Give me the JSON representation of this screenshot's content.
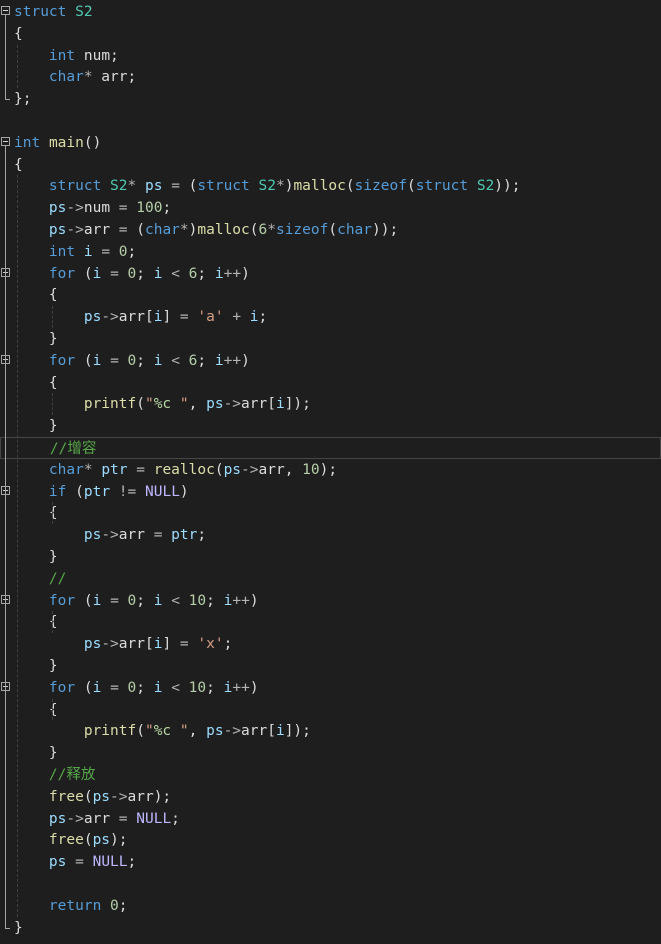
{
  "editor": {
    "language": "C",
    "colors": {
      "background": "#1e1e1e",
      "keyword": "#569cd6",
      "type": "#4ec9b0",
      "number": "#b5cea8",
      "string": "#d69d85",
      "comment": "#57a64a",
      "function": "#dcdcaa",
      "macro": "#beb7ff",
      "local": "#9cdcfe",
      "operator": "#b4b4b4",
      "plain": "#dcdcdc"
    },
    "current_line": 20,
    "lines": [
      {
        "fold": true,
        "tokens": [
          [
            "kw",
            "struct"
          ],
          [
            "plain",
            " "
          ],
          [
            "type",
            "S2"
          ]
        ]
      },
      {
        "tokens": [
          [
            "plain",
            "{"
          ]
        ]
      },
      {
        "tokens": [
          [
            "plain",
            "    "
          ],
          [
            "kw",
            "int"
          ],
          [
            "plain",
            " num;"
          ]
        ]
      },
      {
        "tokens": [
          [
            "plain",
            "    "
          ],
          [
            "kw",
            "char"
          ],
          [
            "op",
            "*"
          ],
          [
            "plain",
            " arr;"
          ]
        ]
      },
      {
        "tokens": [
          [
            "plain",
            "};"
          ]
        ]
      },
      {
        "tokens": []
      },
      {
        "fold": true,
        "tokens": [
          [
            "kw",
            "int"
          ],
          [
            "plain",
            " "
          ],
          [
            "fn",
            "main"
          ],
          [
            "plain",
            "()"
          ]
        ]
      },
      {
        "tokens": [
          [
            "plain",
            "{"
          ]
        ]
      },
      {
        "tokens": [
          [
            "plain",
            "    "
          ],
          [
            "kw",
            "struct"
          ],
          [
            "plain",
            " "
          ],
          [
            "type",
            "S2"
          ],
          [
            "op",
            "*"
          ],
          [
            "plain",
            " "
          ],
          [
            "local",
            "ps"
          ],
          [
            "plain",
            " "
          ],
          [
            "op",
            "="
          ],
          [
            "plain",
            " ("
          ],
          [
            "kw",
            "struct"
          ],
          [
            "plain",
            " "
          ],
          [
            "type",
            "S2"
          ],
          [
            "op",
            "*"
          ],
          [
            "plain",
            ")"
          ],
          [
            "fn",
            "malloc"
          ],
          [
            "plain",
            "("
          ],
          [
            "kw",
            "sizeof"
          ],
          [
            "plain",
            "("
          ],
          [
            "kw",
            "struct"
          ],
          [
            "plain",
            " "
          ],
          [
            "type",
            "S2"
          ],
          [
            "plain",
            "));"
          ]
        ]
      },
      {
        "tokens": [
          [
            "plain",
            "    "
          ],
          [
            "local",
            "ps"
          ],
          [
            "op",
            "->"
          ],
          [
            "plain",
            "num "
          ],
          [
            "op",
            "="
          ],
          [
            "plain",
            " "
          ],
          [
            "num",
            "100"
          ],
          [
            "plain",
            ";"
          ]
        ]
      },
      {
        "tokens": [
          [
            "plain",
            "    "
          ],
          [
            "local",
            "ps"
          ],
          [
            "op",
            "->"
          ],
          [
            "plain",
            "arr "
          ],
          [
            "op",
            "="
          ],
          [
            "plain",
            " ("
          ],
          [
            "kw",
            "char"
          ],
          [
            "op",
            "*"
          ],
          [
            "plain",
            ")"
          ],
          [
            "fn",
            "malloc"
          ],
          [
            "plain",
            "("
          ],
          [
            "num",
            "6"
          ],
          [
            "op",
            "*"
          ],
          [
            "kw",
            "sizeof"
          ],
          [
            "plain",
            "("
          ],
          [
            "kw",
            "char"
          ],
          [
            "plain",
            "));"
          ]
        ]
      },
      {
        "tokens": [
          [
            "plain",
            "    "
          ],
          [
            "kw",
            "int"
          ],
          [
            "plain",
            " "
          ],
          [
            "local",
            "i"
          ],
          [
            "plain",
            " "
          ],
          [
            "op",
            "="
          ],
          [
            "plain",
            " "
          ],
          [
            "num",
            "0"
          ],
          [
            "plain",
            ";"
          ]
        ]
      },
      {
        "fold": true,
        "tokens": [
          [
            "plain",
            "    "
          ],
          [
            "kw",
            "for"
          ],
          [
            "plain",
            " ("
          ],
          [
            "local",
            "i"
          ],
          [
            "plain",
            " "
          ],
          [
            "op",
            "="
          ],
          [
            "plain",
            " "
          ],
          [
            "num",
            "0"
          ],
          [
            "plain",
            "; "
          ],
          [
            "local",
            "i"
          ],
          [
            "plain",
            " "
          ],
          [
            "op",
            "<"
          ],
          [
            "plain",
            " "
          ],
          [
            "num",
            "6"
          ],
          [
            "plain",
            "; "
          ],
          [
            "local",
            "i"
          ],
          [
            "op",
            "++"
          ],
          [
            "plain",
            ")"
          ]
        ]
      },
      {
        "tokens": [
          [
            "plain",
            "    {"
          ]
        ]
      },
      {
        "tokens": [
          [
            "plain",
            "        "
          ],
          [
            "local",
            "ps"
          ],
          [
            "op",
            "->"
          ],
          [
            "plain",
            "arr["
          ],
          [
            "local",
            "i"
          ],
          [
            "plain",
            "] "
          ],
          [
            "op",
            "="
          ],
          [
            "plain",
            " "
          ],
          [
            "str",
            "'a'"
          ],
          [
            "plain",
            " "
          ],
          [
            "op",
            "+"
          ],
          [
            "plain",
            " "
          ],
          [
            "local",
            "i"
          ],
          [
            "plain",
            ";"
          ]
        ]
      },
      {
        "tokens": [
          [
            "plain",
            "    }"
          ]
        ]
      },
      {
        "fold": true,
        "tokens": [
          [
            "plain",
            "    "
          ],
          [
            "kw",
            "for"
          ],
          [
            "plain",
            " ("
          ],
          [
            "local",
            "i"
          ],
          [
            "plain",
            " "
          ],
          [
            "op",
            "="
          ],
          [
            "plain",
            " "
          ],
          [
            "num",
            "0"
          ],
          [
            "plain",
            "; "
          ],
          [
            "local",
            "i"
          ],
          [
            "plain",
            " "
          ],
          [
            "op",
            "<"
          ],
          [
            "plain",
            " "
          ],
          [
            "num",
            "6"
          ],
          [
            "plain",
            "; "
          ],
          [
            "local",
            "i"
          ],
          [
            "op",
            "++"
          ],
          [
            "plain",
            ")"
          ]
        ]
      },
      {
        "tokens": [
          [
            "plain",
            "    {"
          ]
        ]
      },
      {
        "tokens": [
          [
            "plain",
            "        "
          ],
          [
            "fn",
            "printf"
          ],
          [
            "plain",
            "("
          ],
          [
            "str",
            "\""
          ],
          [
            "fmt",
            "%c"
          ],
          [
            "str",
            " \""
          ],
          [
            "plain",
            ", "
          ],
          [
            "local",
            "ps"
          ],
          [
            "op",
            "->"
          ],
          [
            "plain",
            "arr["
          ],
          [
            "local",
            "i"
          ],
          [
            "plain",
            "]);"
          ]
        ]
      },
      {
        "tokens": [
          [
            "plain",
            "    }"
          ]
        ]
      },
      {
        "tokens": [
          [
            "plain",
            "    "
          ],
          [
            "cmt",
            "//增容"
          ]
        ]
      },
      {
        "tokens": [
          [
            "plain",
            "    "
          ],
          [
            "kw",
            "char"
          ],
          [
            "op",
            "*"
          ],
          [
            "plain",
            " "
          ],
          [
            "local",
            "ptr"
          ],
          [
            "plain",
            " "
          ],
          [
            "op",
            "="
          ],
          [
            "plain",
            " "
          ],
          [
            "fn",
            "realloc"
          ],
          [
            "plain",
            "("
          ],
          [
            "local",
            "ps"
          ],
          [
            "op",
            "->"
          ],
          [
            "plain",
            "arr, "
          ],
          [
            "num",
            "10"
          ],
          [
            "plain",
            ");"
          ]
        ]
      },
      {
        "fold": true,
        "tokens": [
          [
            "plain",
            "    "
          ],
          [
            "kw",
            "if"
          ],
          [
            "plain",
            " ("
          ],
          [
            "local",
            "ptr"
          ],
          [
            "plain",
            " "
          ],
          [
            "op",
            "!="
          ],
          [
            "plain",
            " "
          ],
          [
            "macro",
            "NULL"
          ],
          [
            "plain",
            ")"
          ]
        ]
      },
      {
        "tokens": [
          [
            "plain",
            "    {"
          ]
        ]
      },
      {
        "tokens": [
          [
            "plain",
            "        "
          ],
          [
            "local",
            "ps"
          ],
          [
            "op",
            "->"
          ],
          [
            "plain",
            "arr "
          ],
          [
            "op",
            "="
          ],
          [
            "plain",
            " "
          ],
          [
            "local",
            "ptr"
          ],
          [
            "plain",
            ";"
          ]
        ]
      },
      {
        "tokens": [
          [
            "plain",
            "    }"
          ]
        ]
      },
      {
        "tokens": [
          [
            "plain",
            "    "
          ],
          [
            "cmt",
            "//"
          ]
        ]
      },
      {
        "fold": true,
        "tokens": [
          [
            "plain",
            "    "
          ],
          [
            "kw",
            "for"
          ],
          [
            "plain",
            " ("
          ],
          [
            "local",
            "i"
          ],
          [
            "plain",
            " "
          ],
          [
            "op",
            "="
          ],
          [
            "plain",
            " "
          ],
          [
            "num",
            "0"
          ],
          [
            "plain",
            "; "
          ],
          [
            "local",
            "i"
          ],
          [
            "plain",
            " "
          ],
          [
            "op",
            "<"
          ],
          [
            "plain",
            " "
          ],
          [
            "num",
            "10"
          ],
          [
            "plain",
            "; "
          ],
          [
            "local",
            "i"
          ],
          [
            "op",
            "++"
          ],
          [
            "plain",
            ")"
          ]
        ]
      },
      {
        "tokens": [
          [
            "plain",
            "    {"
          ]
        ]
      },
      {
        "tokens": [
          [
            "plain",
            "        "
          ],
          [
            "local",
            "ps"
          ],
          [
            "op",
            "->"
          ],
          [
            "plain",
            "arr["
          ],
          [
            "local",
            "i"
          ],
          [
            "plain",
            "] "
          ],
          [
            "op",
            "="
          ],
          [
            "plain",
            " "
          ],
          [
            "str",
            "'x'"
          ],
          [
            "plain",
            ";"
          ]
        ]
      },
      {
        "tokens": [
          [
            "plain",
            "    }"
          ]
        ]
      },
      {
        "fold": true,
        "tokens": [
          [
            "plain",
            "    "
          ],
          [
            "kw",
            "for"
          ],
          [
            "plain",
            " ("
          ],
          [
            "local",
            "i"
          ],
          [
            "plain",
            " "
          ],
          [
            "op",
            "="
          ],
          [
            "plain",
            " "
          ],
          [
            "num",
            "0"
          ],
          [
            "plain",
            "; "
          ],
          [
            "local",
            "i"
          ],
          [
            "plain",
            " "
          ],
          [
            "op",
            "<"
          ],
          [
            "plain",
            " "
          ],
          [
            "num",
            "10"
          ],
          [
            "plain",
            "; "
          ],
          [
            "local",
            "i"
          ],
          [
            "op",
            "++"
          ],
          [
            "plain",
            ")"
          ]
        ]
      },
      {
        "tokens": [
          [
            "plain",
            "    {"
          ]
        ]
      },
      {
        "tokens": [
          [
            "plain",
            "        "
          ],
          [
            "fn",
            "printf"
          ],
          [
            "plain",
            "("
          ],
          [
            "str",
            "\""
          ],
          [
            "fmt",
            "%c"
          ],
          [
            "str",
            " \""
          ],
          [
            "plain",
            ", "
          ],
          [
            "local",
            "ps"
          ],
          [
            "op",
            "->"
          ],
          [
            "plain",
            "arr["
          ],
          [
            "local",
            "i"
          ],
          [
            "plain",
            "]);"
          ]
        ]
      },
      {
        "tokens": [
          [
            "plain",
            "    }"
          ]
        ]
      },
      {
        "tokens": [
          [
            "plain",
            "    "
          ],
          [
            "cmt",
            "//释放"
          ]
        ]
      },
      {
        "tokens": [
          [
            "plain",
            "    "
          ],
          [
            "fn",
            "free"
          ],
          [
            "plain",
            "("
          ],
          [
            "local",
            "ps"
          ],
          [
            "op",
            "->"
          ],
          [
            "plain",
            "arr);"
          ]
        ]
      },
      {
        "tokens": [
          [
            "plain",
            "    "
          ],
          [
            "local",
            "ps"
          ],
          [
            "op",
            "->"
          ],
          [
            "plain",
            "arr "
          ],
          [
            "op",
            "="
          ],
          [
            "plain",
            " "
          ],
          [
            "macro",
            "NULL"
          ],
          [
            "plain",
            ";"
          ]
        ]
      },
      {
        "tokens": [
          [
            "plain",
            "    "
          ],
          [
            "fn",
            "free"
          ],
          [
            "plain",
            "("
          ],
          [
            "local",
            "ps"
          ],
          [
            "plain",
            ");"
          ]
        ]
      },
      {
        "tokens": [
          [
            "plain",
            "    "
          ],
          [
            "local",
            "ps"
          ],
          [
            "plain",
            " "
          ],
          [
            "op",
            "="
          ],
          [
            "plain",
            " "
          ],
          [
            "macro",
            "NULL"
          ],
          [
            "plain",
            ";"
          ]
        ]
      },
      {
        "tokens": []
      },
      {
        "tokens": [
          [
            "plain",
            "    "
          ],
          [
            "kw",
            "return"
          ],
          [
            "plain",
            " "
          ],
          [
            "num",
            "0"
          ],
          [
            "plain",
            ";"
          ]
        ]
      },
      {
        "tokens": [
          [
            "plain",
            "}"
          ]
        ]
      }
    ]
  }
}
